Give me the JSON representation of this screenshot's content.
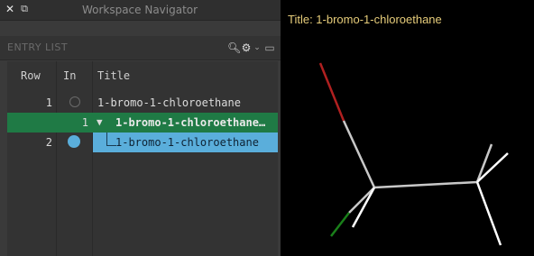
{
  "navigator": {
    "window_title": "Workspace Navigator",
    "section_label": "ENTRY LIST",
    "columns": {
      "row": "Row",
      "in": "In",
      "title": "Title"
    },
    "rows": [
      {
        "row": "1",
        "in_state": "empty",
        "title": "1-bromo-1-chloroethane"
      },
      {
        "row": "",
        "in_state": "count",
        "in_count": "1",
        "expand": "▼",
        "title": "1-bromo-1-chloroethane…"
      },
      {
        "row": "2",
        "in_state": "included",
        "title": "1-bromo-1-chloroethane"
      }
    ]
  },
  "workspace": {
    "title": "Title: 1-bromo-1-chloroethane"
  },
  "colors": {
    "selected": "#5aaedb",
    "group": "#1f7a45",
    "title_text": "#e6cc7a",
    "bond_gray": "#c8c8c8",
    "bond_red": "#b02020",
    "bond_green": "#1a7f1a"
  }
}
